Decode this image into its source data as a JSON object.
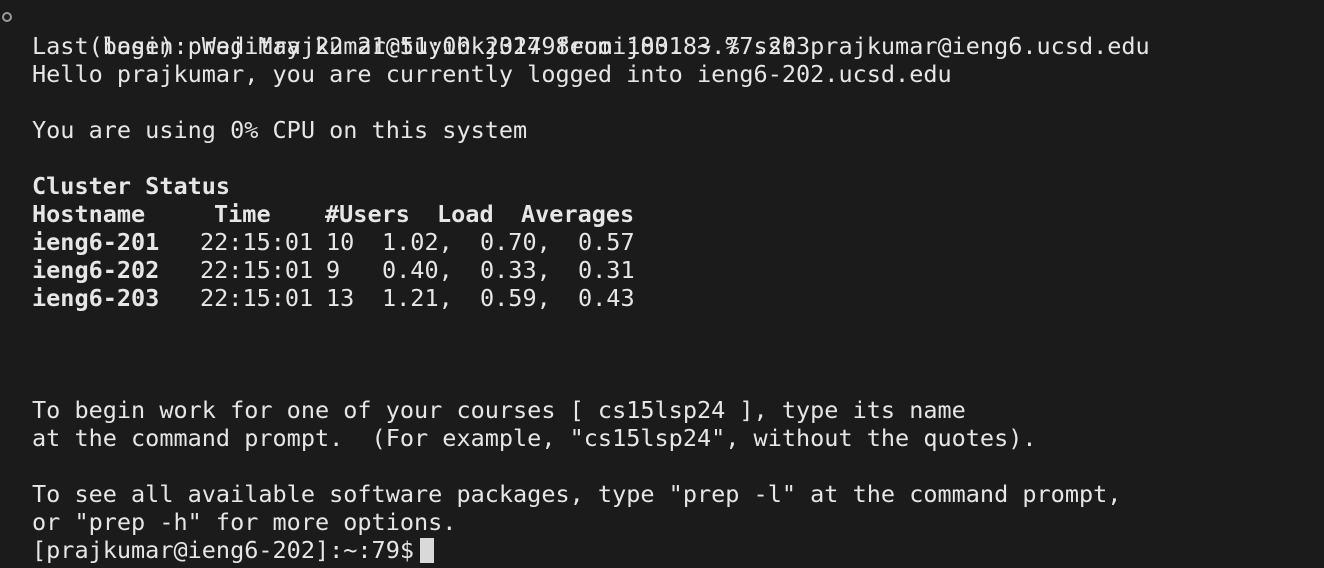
{
  "terminal": {
    "command_line": "(base) prajitrajkumar@tuyihkj31798euoij831 ~ % ssh prajkumar@ieng6.ucsd.edu",
    "last_login": "Last login: Wed May 22 21:51:00 2024 from 100.83.77.203",
    "hello": "Hello prajkumar, you are currently logged into ieng6-202.ucsd.edu",
    "cpu": "You are using 0% CPU on this system",
    "cluster_title": "Cluster Status",
    "table_headers": {
      "hostname": "Hostname",
      "time": "Time",
      "users": "#Users",
      "load": "Load",
      "averages": "Averages"
    },
    "rows": [
      {
        "host": "ieng6-201",
        "time": "22:15:01",
        "users": "10",
        "l1": "1.02,",
        "l2": "0.70,",
        "l3": "0.57"
      },
      {
        "host": "ieng6-202",
        "time": "22:15:01",
        "users": "9",
        "l1": "0.40,",
        "l2": "0.33,",
        "l3": "0.31"
      },
      {
        "host": "ieng6-203",
        "time": "22:15:01",
        "users": "13",
        "l1": "1.21,",
        "l2": "0.59,",
        "l3": "0.43"
      }
    ],
    "courses_line1": "To begin work for one of your courses [ cs15lsp24 ], type its name",
    "courses_line2": "at the command prompt.  (For example, \"cs15lsp24\", without the quotes).",
    "prep_line1": "To see all available software packages, type \"prep -l\" at the command prompt,",
    "prep_line2": "or \"prep -h\" for more options.",
    "final_prompt": "[prajkumar@ieng6-202]:~:79$"
  }
}
